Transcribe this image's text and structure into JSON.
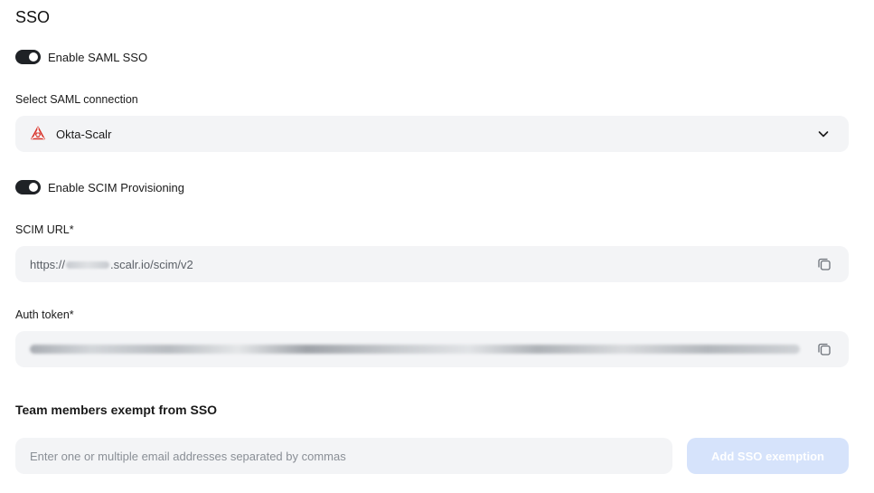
{
  "page": {
    "title": "SSO"
  },
  "saml": {
    "toggle_label": "Enable SAML SSO",
    "toggle_on": true,
    "connection_label": "Select SAML connection",
    "connection_value": "Okta-Scalr",
    "connection_icon": "okta-icon"
  },
  "scim": {
    "toggle_label": "Enable SCIM Provisioning",
    "toggle_on": true,
    "url_label": "SCIM URL*",
    "url_prefix": "https://",
    "url_suffix": ".scalr.io/scim/v2",
    "token_label": "Auth token*",
    "copy_icon": "copy-icon"
  },
  "exemptions": {
    "heading": "Team members exempt from SSO",
    "input_placeholder": "Enter one or multiple email addresses separated by commas",
    "add_button_label": "Add SSO exemption"
  },
  "colors": {
    "toggle_on": "#1f2226",
    "field_bg": "#f3f4f6",
    "button_disabled_bg": "#d6e3fb",
    "okta_red": "#d9342b"
  }
}
